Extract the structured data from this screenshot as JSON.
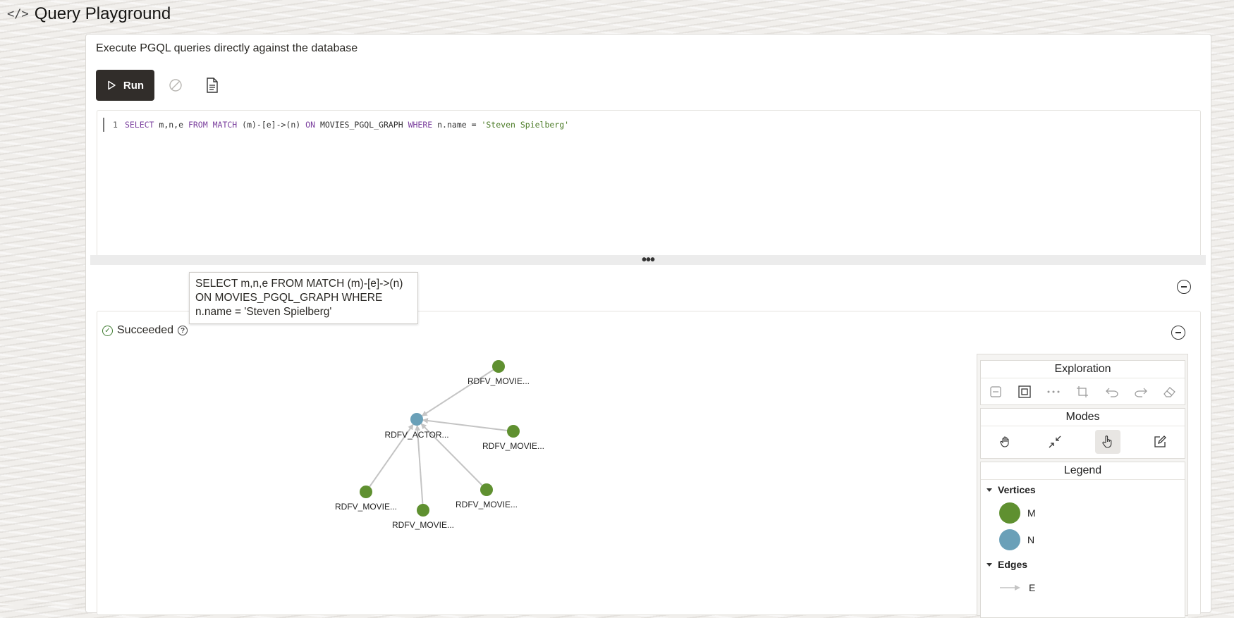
{
  "header": {
    "title": "Query Playground",
    "icon": "code-icon"
  },
  "description": "Execute PGQL queries directly against the database",
  "toolbar": {
    "run_label": "Run",
    "cancel_icon": "cancel-icon",
    "doc_icon": "document-icon"
  },
  "editor": {
    "line_number": "1",
    "tokens": {
      "t1": "SELECT",
      "t2": " m,n,e ",
      "t3": "FROM",
      "t4": " ",
      "t5": "MATCH",
      "t6": " (m)-[e]->(n) ",
      "t7": "ON",
      "t8": " MOVIES_PGQL_GRAPH ",
      "t9": "WHERE",
      "t10": " n.name = ",
      "t11": "'Steven Spielberg'"
    }
  },
  "tooltip": "SELECT m,n,e FROM MATCH (m)-[e]->(n) ON MOVIES_PGQL_GRAPH WHERE n.name = 'Steven Spielberg'",
  "result": {
    "status": "Succeeded"
  },
  "graph": {
    "colors": {
      "m": "#5f9030",
      "n": "#6aa0b8",
      "edge": "#c4c4c4"
    },
    "nodes": [
      {
        "label": "RDFV_ACTOR...",
        "type": "n"
      },
      {
        "label": "RDFV_MOVIE...",
        "type": "m"
      },
      {
        "label": "RDFV_MOVIE...",
        "type": "m"
      },
      {
        "label": "RDFV_MOVIE...",
        "type": "m"
      },
      {
        "label": "RDFV_MOVIE...",
        "type": "m"
      },
      {
        "label": "RDFV_MOVIE...",
        "type": "m"
      }
    ]
  },
  "side": {
    "exploration_title": "Exploration",
    "exploration_icons": [
      "collapse-icon",
      "fit-icon",
      "more-icon",
      "crop-icon",
      "undo-icon",
      "redo-icon",
      "eraser-icon"
    ],
    "modes_title": "Modes",
    "modes_icons": [
      "hand-icon",
      "shrink-icon",
      "pointer-icon",
      "edit-icon"
    ],
    "legend_title": "Legend",
    "vertices_label": "Vertices",
    "vertex_m": "M",
    "vertex_n": "N",
    "edges_label": "Edges",
    "edge_e": "E"
  }
}
